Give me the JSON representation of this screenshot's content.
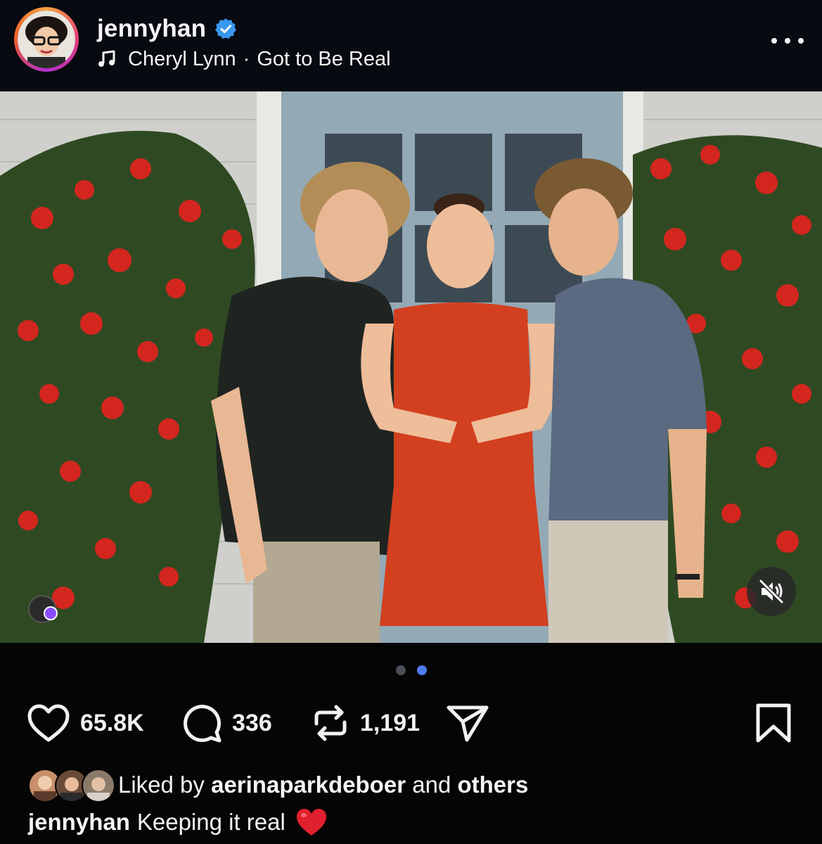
{
  "post": {
    "username": "jennyhan",
    "verified": true,
    "music": {
      "artist": "Cheryl Lynn",
      "separator": "·",
      "song": "Got to Be Real"
    }
  },
  "carousel": {
    "count": 2,
    "active_index": 1
  },
  "actions": {
    "likes": "65.8K",
    "comments": "336",
    "reposts": "1,191"
  },
  "liked_by": {
    "prefix": "Liked by",
    "user": "aerinaparkdeboer",
    "conjunction": "and",
    "others": "others"
  },
  "caption": {
    "username": "jennyhan",
    "text": "Keeping it real",
    "emoji": "heart-emoji"
  },
  "icons": {
    "verified": "verified-badge-icon",
    "music": "music-note-icon",
    "more": "more-options-icon",
    "like": "heart-icon",
    "comment": "comment-icon",
    "repost": "repost-icon",
    "share": "send-icon",
    "save": "bookmark-icon",
    "mute": "muted-speaker-icon"
  },
  "colors": {
    "accent_blue": "#4e7cf0",
    "verified_blue": "#3897f0",
    "background": "#050505",
    "heart_red": "#e0202c"
  }
}
